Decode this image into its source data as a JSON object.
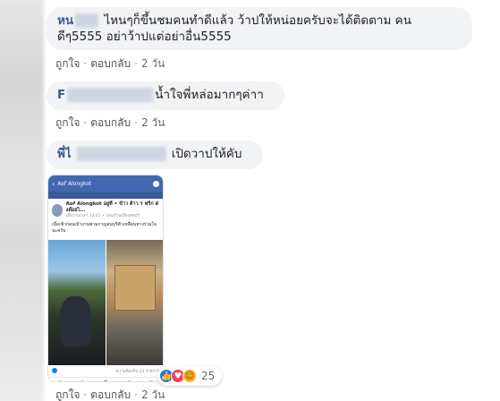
{
  "comments": [
    {
      "author_visible": "หน",
      "text_line1": "ไหนๆก็ขึ้นชมคนทำดีแล้ว ว้าปให้หน่อยครับจะได้ติดตาม คน",
      "text_line2": "ดีๆ5555 อย่าว้าปแต่อย่าอื่น5555",
      "actions": {
        "like": "ถูกใจ",
        "reply": "ตอบกลับ",
        "time": "2 วัน"
      }
    },
    {
      "author_visible": "F",
      "text": "น้ำใจพี่หล่อมากๆค่าา",
      "actions": {
        "like": "ถูกใจ",
        "reply": "ตอบกลับ",
        "time": "2 วัน"
      }
    },
    {
      "author_visible": "พี่ไ",
      "text": "เปิดวาปให้คับ",
      "actions": {
        "like": "ถูกใจ",
        "reply": "ตอบกลับ",
        "time": "2 วัน"
      },
      "reactions": {
        "count": "25",
        "icons": [
          "like-icon",
          "love-icon",
          "haha-icon"
        ]
      },
      "attachment": {
        "profile_name": "Aof Alongkot",
        "post_author": "Aof Alongkot อยู่ที่ • ข้าว ต้าว ร ฟรีก ด่งด๊อย่ไ...",
        "post_meta": "เมื่อวานเวลา 12:41 • แผนบ้านเมืองลพบุรี",
        "post_text": "เมื่อเช้าก่อนเข้างานพ่ามกาญจนบุรีตัวเหลื่อนทางร่วมใจนะครับ",
        "stats": "ความคิดเห็น 23 รายการ"
      }
    }
  ],
  "colors": {
    "author": "#385898",
    "bubble": "#f2f3f5",
    "meta": "#606770",
    "like": "#2078f4",
    "love": "#f33e58",
    "haha": "#f7b125"
  }
}
